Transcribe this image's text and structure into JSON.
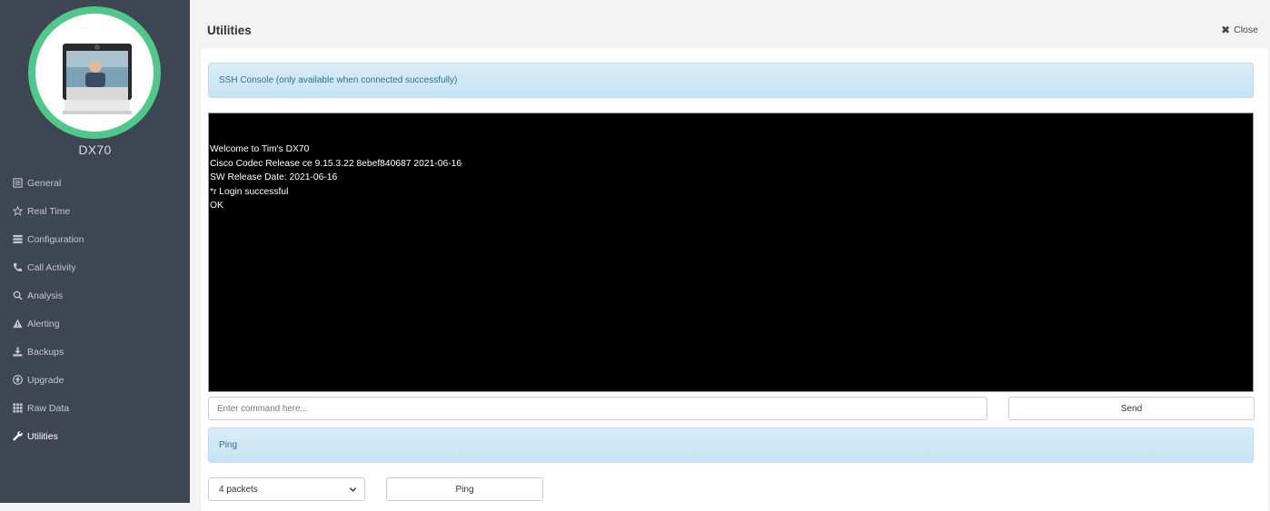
{
  "sidebar": {
    "device_name": "DX70",
    "items": [
      {
        "label": "General",
        "icon": "list-icon"
      },
      {
        "label": "Real Time",
        "icon": "star-icon"
      },
      {
        "label": "Configuration",
        "icon": "server-icon"
      },
      {
        "label": "Call Activity",
        "icon": "phone-icon"
      },
      {
        "label": "Analysis",
        "icon": "search-icon"
      },
      {
        "label": "Alerting",
        "icon": "warning-icon"
      },
      {
        "label": "Backups",
        "icon": "download-icon"
      },
      {
        "label": "Upgrade",
        "icon": "upgrade-icon"
      },
      {
        "label": "Raw Data",
        "icon": "grid-icon"
      },
      {
        "label": "Utilities",
        "icon": "wrench-icon",
        "active": true
      }
    ]
  },
  "header": {
    "title": "Utilities",
    "close_label": "Close"
  },
  "ssh": {
    "heading": "SSH Console (only available when connected successfully)",
    "console_lines": [
      "Welcome to Tim's DX70",
      "Cisco Codec Release ce 9.15.3.22 8ebef840687 2021-06-16",
      "SW Release Date: 2021-06-16",
      "*r Login successful",
      "OK"
    ],
    "input_placeholder": "Enter command here...",
    "input_value": "",
    "send_label": "Send"
  },
  "ping": {
    "heading": "Ping",
    "packets_selected": "4 packets",
    "ping_label": "Ping"
  },
  "colors": {
    "sidebar_bg": "#3e4654",
    "avatar_ring": "#4fc88a",
    "panel_heading_bg": "#d9edf7",
    "panel_heading_text": "#31708f",
    "console_bg": "#000000"
  }
}
